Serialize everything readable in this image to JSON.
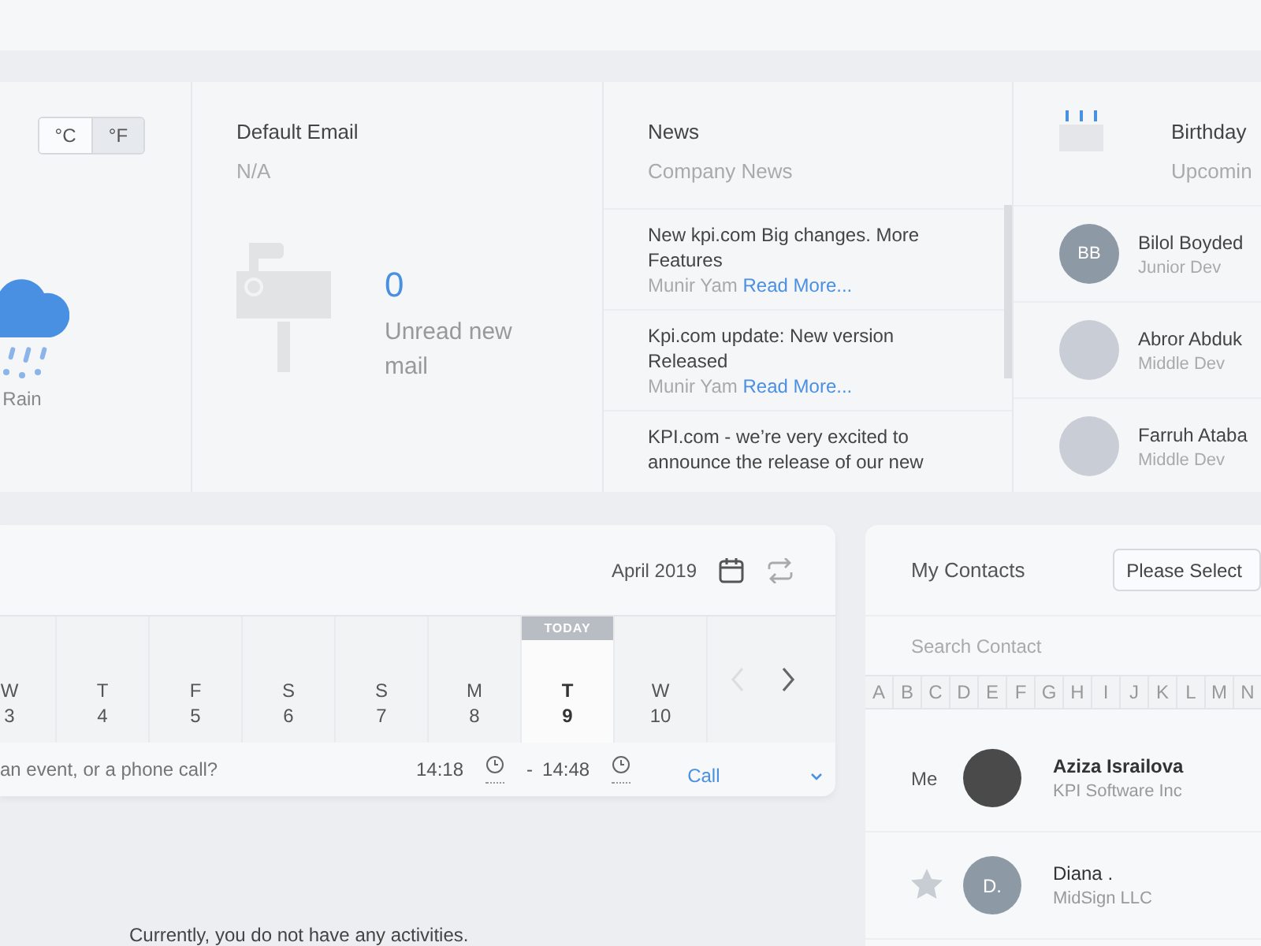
{
  "weather": {
    "units": [
      {
        "label": "°C",
        "selected": false
      },
      {
        "label": "°F",
        "selected": true
      }
    ],
    "condition": "Rain"
  },
  "email": {
    "title": "Default Email",
    "address": "N/A",
    "unread_count": "0",
    "unread_label": "Unread new mail"
  },
  "news": {
    "title": "News",
    "subtitle": "Company News",
    "items": [
      {
        "title": "New kpi.com Big changes. More Features",
        "author": "Munir Yam",
        "link": "Read More..."
      },
      {
        "title": "Kpi.com update: New version Released",
        "author": "Munir Yam",
        "link": "Read More..."
      },
      {
        "title": "KPI.com - we’re very excited to announce the release of our new"
      }
    ]
  },
  "birthday": {
    "title": "Birthday",
    "subtitle": "Upcomin",
    "people": [
      {
        "name": "Bilol Boyded",
        "role": "Junior Dev",
        "initials": "BB"
      },
      {
        "name": "Abror Abduk",
        "role": "Middle Dev"
      },
      {
        "name": "Farruh Ataba",
        "role": "Middle Dev"
      }
    ]
  },
  "calendar": {
    "month": "April 2019",
    "today_label": "TODAY",
    "days": [
      {
        "weekday": "W",
        "day": "3",
        "today": false
      },
      {
        "weekday": "T",
        "day": "4",
        "today": false
      },
      {
        "weekday": "F",
        "day": "5",
        "today": false
      },
      {
        "weekday": "S",
        "day": "6",
        "today": false
      },
      {
        "weekday": "S",
        "day": "7",
        "today": false
      },
      {
        "weekday": "M",
        "day": "8",
        "today": false
      },
      {
        "weekday": "T",
        "day": "9",
        "today": true
      },
      {
        "weekday": "W",
        "day": "10",
        "today": false
      }
    ],
    "task_placeholder": "an event, or a phone call?",
    "start_time": "14:18",
    "separator": "-",
    "end_time": "14:48",
    "type": "Call",
    "empty_message": "Currently, you do not have any activities."
  },
  "contacts": {
    "title": "My Contacts",
    "filter": "Please Select",
    "search_placeholder": "Search Contact",
    "letters": [
      "A",
      "B",
      "C",
      "D",
      "E",
      "F",
      "G",
      "H",
      "I",
      "J",
      "K",
      "L",
      "M",
      "N"
    ],
    "people": [
      {
        "kind": "me",
        "label": "Me",
        "name": "Aziza Israilova",
        "company": "KPI Software Inc"
      },
      {
        "kind": "contact",
        "initials": "D.",
        "name": "Diana .",
        "company": "MidSign LLC"
      }
    ]
  }
}
